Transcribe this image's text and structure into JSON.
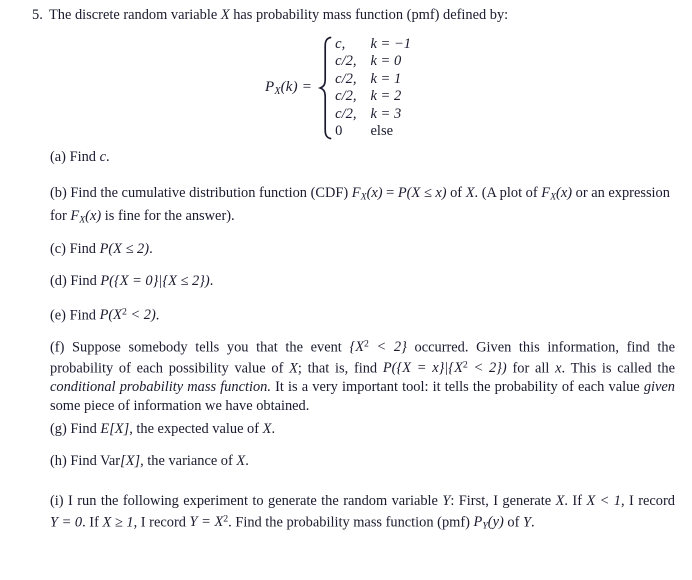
{
  "document": {
    "type": "probability-homework-problem",
    "background_color": "#ffffff",
    "text_color": "#1a1a2e"
  },
  "problem": {
    "number": "5.",
    "stem_before_X": "The discrete random variable ",
    "random_variable": "X",
    "stem_after_X": " has probability mass function (pmf) defined by:"
  },
  "pmf": {
    "lhs_P": "P",
    "lhs_sub": "X",
    "lhs_arg": "(k) =",
    "cases": [
      {
        "value": "c,",
        "condition_k": "k",
        "condition_rel": "=",
        "condition_val": "−1",
        "condition_full": "k = −1"
      },
      {
        "value": "c/2,",
        "condition_k": "k",
        "condition_rel": "=",
        "condition_val": "0",
        "condition_full": "k = 0"
      },
      {
        "value": "c/2,",
        "condition_k": "k",
        "condition_rel": "=",
        "condition_val": "1",
        "condition_full": "k = 1"
      },
      {
        "value": "c/2,",
        "condition_k": "k",
        "condition_rel": "=",
        "condition_val": "2",
        "condition_full": "k = 2"
      },
      {
        "value": "c/2,",
        "condition_k": "k",
        "condition_rel": "=",
        "condition_val": "3",
        "condition_full": "k = 3"
      },
      {
        "value": "0",
        "condition_k": "",
        "condition_rel": "",
        "condition_val": "",
        "condition_full": "else"
      }
    ]
  },
  "parts": {
    "a": {
      "label": "(a)",
      "text_1": "Find ",
      "math_c": "c",
      "text_2": "."
    },
    "b": {
      "label": "(b)",
      "text_1": "Find the cumulative distribution function (CDF) ",
      "math_F": "F",
      "math_F_sub": "X",
      "math_F_arg": "(x)",
      "eq": " = ",
      "math_P": "P",
      "math_P_arg": "(X ≤ x)",
      "text_2": " of ",
      "math_X": "X",
      "text_3": ". (A plot of ",
      "math_F2": "F",
      "math_F2_sub": "X",
      "math_F2_arg": "(x)",
      "text_4": " or an expression for ",
      "math_F3": "F",
      "math_F3_sub": "X",
      "math_F3_arg": "(x)",
      "text_5": " is fine for the answer)."
    },
    "c": {
      "label": "(c)",
      "text_1": "Find ",
      "math": "P(X ≤ 2)",
      "text_2": "."
    },
    "d": {
      "label": "(d)",
      "text_1": "Find ",
      "math": "P({X = 0}|{X ≤ 2})",
      "text_2": "."
    },
    "e": {
      "label": "(e)",
      "text_1": "Find ",
      "math_P": "P(X",
      "math_sup": "2",
      "math_rest": " < 2)",
      "text_2": "."
    },
    "f": {
      "label": "(f)",
      "text_1": "Suppose somebody tells you that the event ",
      "math_event": "{X",
      "math_event_sup": "2",
      "math_event_rest": " < 2}",
      "text_2": " occurred. Given this information, find the probability of each possibility value of ",
      "math_X": "X",
      "text_3": "; that is, find ",
      "math_cond": "P({X = x}|{X",
      "math_cond_sup": "2",
      "math_cond_rest": " < 2})",
      "text_4": " for all ",
      "math_x": "x",
      "text_5": ". This is called the ",
      "italic_term": "conditional probability mass function.",
      "text_6": " It is a very important tool: it tells the probability of each value ",
      "italic_given": "given",
      "text_7": " some piece of information we have obtained."
    },
    "g": {
      "label": "(g)",
      "text_1": "Find ",
      "math_E": "E",
      "math_E_arg": "[X]",
      "text_2": ", the expected value of ",
      "math_X": "X",
      "text_3": "."
    },
    "h": {
      "label": "(h)",
      "text_1": "Find ",
      "math_Var": "Var",
      "math_Var_arg": "[X]",
      "text_2": ", the variance of ",
      "math_X": "X",
      "text_3": "."
    },
    "i": {
      "label": "(i)",
      "text_1": "I run the following experiment to generate the random variable ",
      "math_Y": "Y",
      "text_2": ": First, I generate ",
      "math_X": "X",
      "text_3": ". If ",
      "math_cond1": "X < 1",
      "text_4": ", I record ",
      "math_Y0": "Y = 0",
      "text_5": ". If ",
      "math_cond2": "X ≥ 1",
      "text_6": ", I record ",
      "math_YX": "Y = X",
      "math_YX_sup": "2",
      "text_7": ". Find the probability mass function (pmf) ",
      "math_PY": "P",
      "math_PY_sub": "Y",
      "math_PY_arg": "(y)",
      "text_8": " of ",
      "math_Y2": "Y",
      "text_9": "."
    }
  }
}
